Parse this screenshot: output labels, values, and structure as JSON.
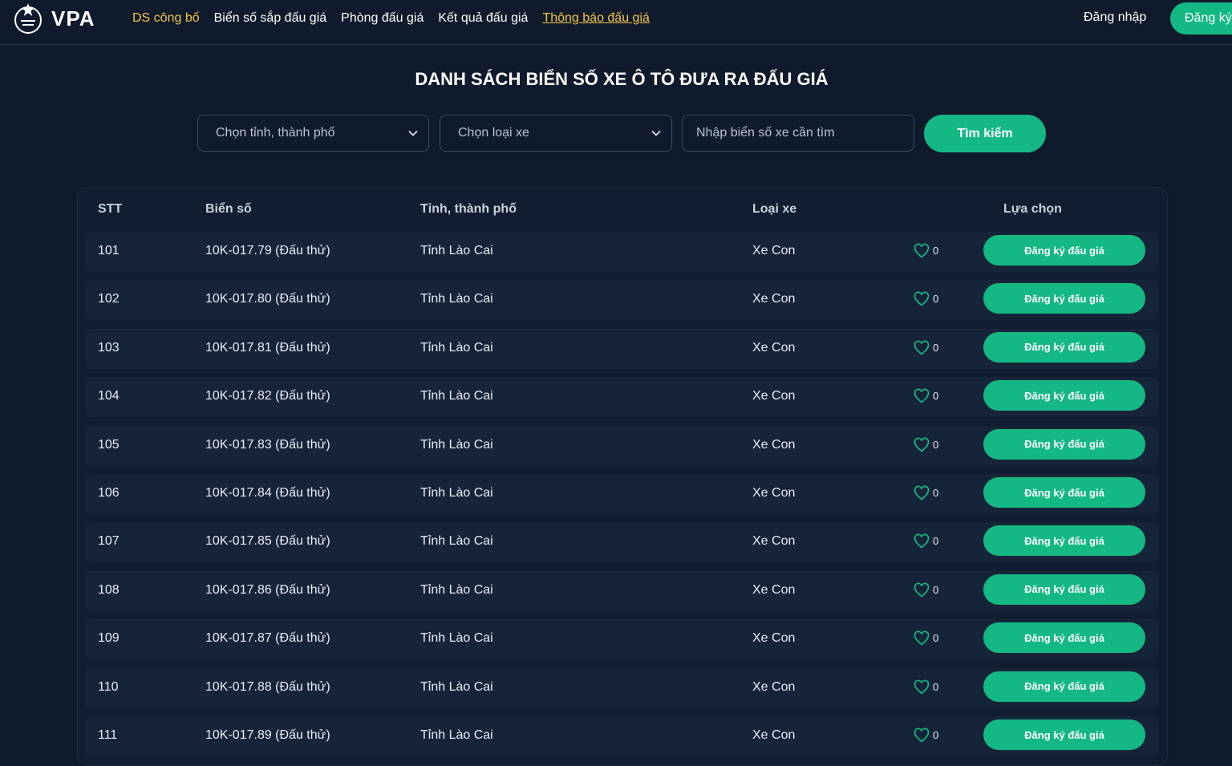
{
  "header": {
    "logo_text": "VPA",
    "nav": [
      {
        "label": "DS công bố"
      },
      {
        "label": "Biển số sắp đấu giá"
      },
      {
        "label": "Phòng đấu giá"
      },
      {
        "label": "Kết quả đấu giá"
      },
      {
        "label": "Thông báo đấu giá"
      }
    ],
    "login_label": "Đăng nhập",
    "register_label": "Đăng ký"
  },
  "page_title": "DANH SÁCH BIỂN SỐ XE Ô TÔ ĐƯA RA ĐẤU GIÁ",
  "filters": {
    "province_placeholder": "Chọn tỉnh, thành phố",
    "vehicle_type_placeholder": "Chọn loại xe",
    "plate_placeholder": "Nhập biển số xe cần tìm",
    "search_label": "Tìm kiếm"
  },
  "table": {
    "columns": [
      "STT",
      "Biển số",
      "Tỉnh, thành phố",
      "Loại xe",
      "Lựa chọn"
    ],
    "action_label": "Đăng ký đấu giá",
    "rows": [
      {
        "stt": "101",
        "plate": "10K-017.79 (Đấu thử)",
        "province": "Tỉnh Lào Cai",
        "type": "Xe Con",
        "likes": "0"
      },
      {
        "stt": "102",
        "plate": "10K-017.80 (Đấu thử)",
        "province": "Tỉnh Lào Cai",
        "type": "Xe Con",
        "likes": "0"
      },
      {
        "stt": "103",
        "plate": "10K-017.81 (Đấu thử)",
        "province": "Tỉnh Lào Cai",
        "type": "Xe Con",
        "likes": "0"
      },
      {
        "stt": "104",
        "plate": "10K-017.82 (Đấu thử)",
        "province": "Tỉnh Lào Cai",
        "type": "Xe Con",
        "likes": "0"
      },
      {
        "stt": "105",
        "plate": "10K-017.83 (Đấu thử)",
        "province": "Tỉnh Lào Cai",
        "type": "Xe Con",
        "likes": "0"
      },
      {
        "stt": "106",
        "plate": "10K-017.84 (Đấu thử)",
        "province": "Tỉnh Lào Cai",
        "type": "Xe Con",
        "likes": "0"
      },
      {
        "stt": "107",
        "plate": "10K-017.85 (Đấu thử)",
        "province": "Tỉnh Lào Cai",
        "type": "Xe Con",
        "likes": "0"
      },
      {
        "stt": "108",
        "plate": "10K-017.86 (Đấu thử)",
        "province": "Tỉnh Lào Cai",
        "type": "Xe Con",
        "likes": "0"
      },
      {
        "stt": "109",
        "plate": "10K-017.87 (Đấu thử)",
        "province": "Tỉnh Lào Cai",
        "type": "Xe Con",
        "likes": "0"
      },
      {
        "stt": "110",
        "plate": "10K-017.88 (Đấu thử)",
        "province": "Tỉnh Lào Cai",
        "type": "Xe Con",
        "likes": "0"
      },
      {
        "stt": "111",
        "plate": "10K-017.89 (Đấu thử)",
        "province": "Tỉnh Lào Cai",
        "type": "Xe Con",
        "likes": "0"
      }
    ]
  },
  "icons": {
    "logo": "star-emblem-icon",
    "dropdown": "chevron-down-icon",
    "like": "heart-icon"
  },
  "colors": {
    "background": "#0f1b2d",
    "accent": "#14b884",
    "highlight": "#f5c542",
    "row_bg": "#16243a"
  }
}
